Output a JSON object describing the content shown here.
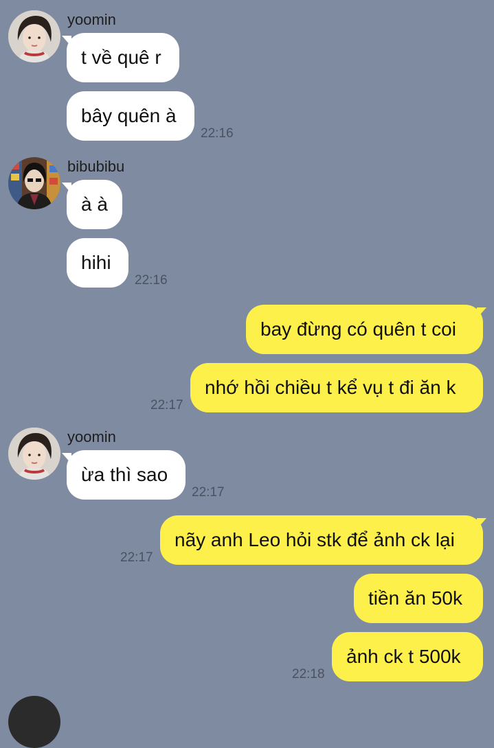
{
  "chat": {
    "messages": [
      {
        "sender": "yoomin",
        "text": "t về quê r"
      },
      {
        "text": "bây quên à",
        "time": "22:16"
      },
      {
        "sender": "bibubibu",
        "text": "à à"
      },
      {
        "text": "hihi",
        "time": "22:16"
      },
      {
        "text": "bay đừng có quên t coi"
      },
      {
        "text": "nhớ hồi chiều t kể vụ t đi ăn k",
        "time": "22:17"
      },
      {
        "sender": "yoomin",
        "text": "ừa thì sao",
        "time": "22:17"
      },
      {
        "text": "nãy anh Leo hỏi stk để ảnh ck lại",
        "time": "22:17"
      },
      {
        "text": "tiền ăn 50k"
      },
      {
        "text": "ảnh ck t 500k",
        "time": "22:18"
      }
    ]
  },
  "colors": {
    "background": "#7f8ba0",
    "incoming_bubble": "#ffffff",
    "outgoing_bubble": "#fdf04a"
  },
  "icons": {
    "avatar_yoomin": "avatar-photo",
    "avatar_bibubibu": "avatar-photo"
  }
}
